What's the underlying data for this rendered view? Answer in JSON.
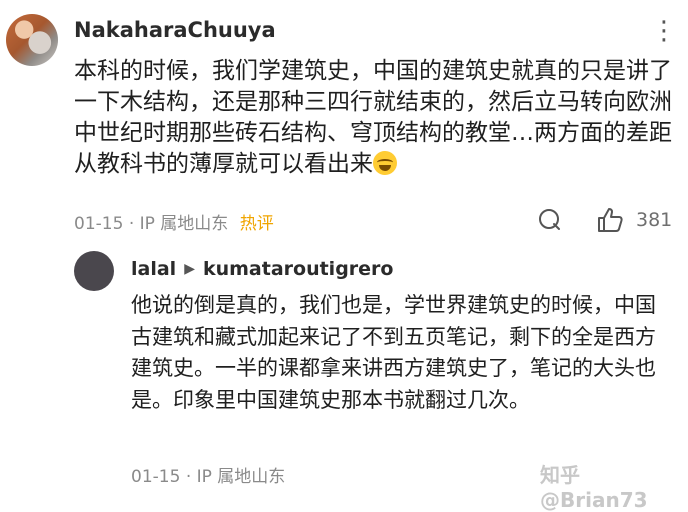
{
  "comment": {
    "author": "NakaharaChuuya",
    "more_icon": "⋮",
    "text": "本科的时候，我们学建筑史，中国的建筑史就真的只是讲了一下木结构，还是那种三四行就结束的，然后立马转向欧洲中世纪时期那些砖石结构、穹顶结构的教堂…两方面的差距从教科书的薄厚就可以看出来",
    "date": "01-15",
    "ip": "IP 属地山东",
    "hot_label": "热评",
    "like_count": "381",
    "emoji_icon": "crying-laughing-emoji"
  },
  "reply": {
    "author": "lalal",
    "arrow": "▶",
    "reply_to": "kumataroutigrero",
    "text": "他说的倒是真的，我们也是，学世界建筑史的时候，中国古建筑和藏式加起来记了不到五页笔记，剩下的全是西方建筑史。一半的课都拿来讲西方建筑史了，笔记的大头也是。印象里中国建筑史那本书就翻过几次。",
    "date": "01-15",
    "ip": "IP 属地山东"
  },
  "watermark": "知乎 @Brian73",
  "colors": {
    "hot": "#f0a500",
    "meta": "#8a8a8a"
  }
}
